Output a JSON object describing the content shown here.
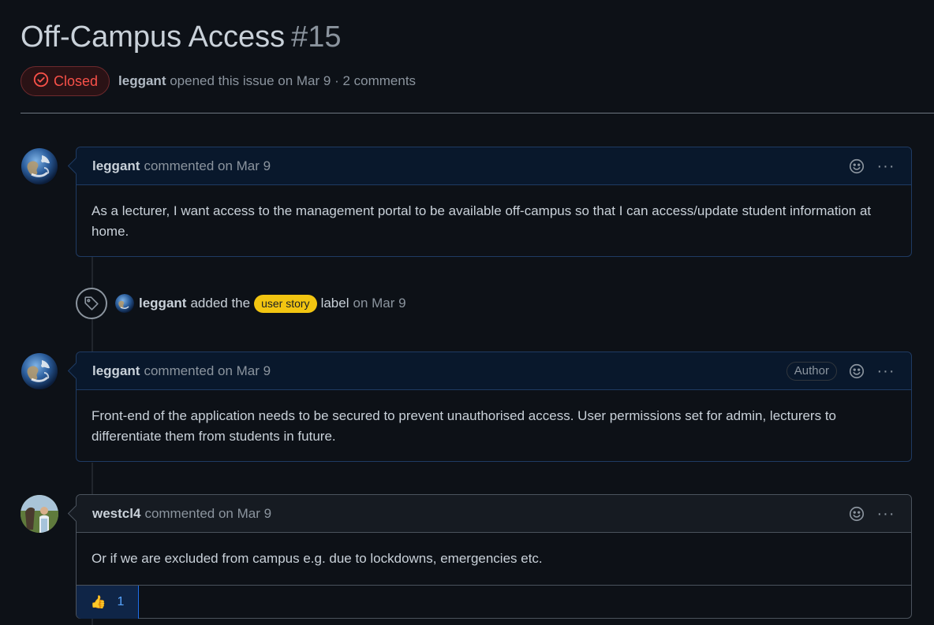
{
  "issue": {
    "title": "Off-Campus Access",
    "number": "#15",
    "state": "Closed",
    "author": "leggant",
    "meta": "opened this issue on Mar 9 · 2 comments"
  },
  "comments": [
    {
      "author": "leggant",
      "action": "commented on Mar 9",
      "body": "As a lecturer, I want access to the management portal to be available off-campus so that I can access/update student information at home."
    },
    {
      "author": "leggant",
      "action": "commented on Mar 9",
      "badge": "Author",
      "body": "Front-end of the application needs to be secured to prevent unauthorised access. User permissions set for admin, lecturers to differentiate them from students in future."
    },
    {
      "author": "westcl4",
      "action": "commented on Mar 9",
      "body": "Or if we are excluded from campus e.g. due to lockdowns, emergencies etc.",
      "reactions": [
        {
          "emoji": "👍",
          "count": "1"
        }
      ]
    }
  ],
  "event": {
    "author": "leggant",
    "prefix": "added the",
    "label": "user story",
    "suffix": "label",
    "date": "on Mar 9",
    "icon": "tag-icon"
  },
  "icons": {
    "state": "circle-check-icon",
    "emoji": "smiley-icon",
    "more": "kebab-horizontal-icon",
    "more_glyph": "···"
  },
  "colors": {
    "background": "#0d1117",
    "closed": "#f85149",
    "label": "#f2c511",
    "accent": "#58a6ff"
  }
}
